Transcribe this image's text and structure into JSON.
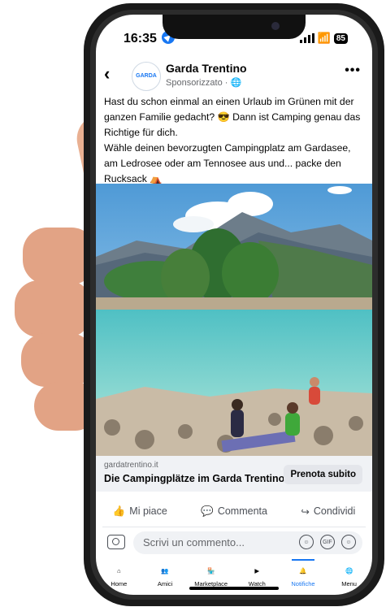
{
  "status": {
    "time": "16:35",
    "battery": "85"
  },
  "post": {
    "page_name": "Garda Trentino",
    "avatar_text": "GARDA",
    "sponsored": "Sponsorizzato · ",
    "caption_line1": "Hast du schon einmal an einen Urlaub im Grünen mit der ganzen Familie gedacht? 😎 Dann ist Camping genau das Richtige für dich.",
    "caption_line2": "Wähle deinen bevorzugten Campingplatz am Gardasee, am Ledrosee oder am Tennosee aus und... packe den Rucksack ⛺"
  },
  "cta": {
    "domain": "gardatrentino.it",
    "title": "Die Campingplätze im Garda Trentino",
    "button": "Prenota subito"
  },
  "actions": {
    "like": "Mi piace",
    "comment": "Commenta",
    "share": "Condividi"
  },
  "comment": {
    "placeholder": "Scrivi un commento...",
    "gif": "GIF"
  },
  "tabs": [
    {
      "label": "Home",
      "icon": "home-icon"
    },
    {
      "label": "Amici",
      "icon": "friends-icon"
    },
    {
      "label": "Marketplace",
      "icon": "marketplace-icon"
    },
    {
      "label": "Watch",
      "icon": "watch-icon"
    },
    {
      "label": "Notifiche",
      "icon": "bell-icon"
    },
    {
      "label": "Menu",
      "icon": "menu-avatar-icon"
    }
  ],
  "colors": {
    "accent": "#1877f2",
    "lake": "#5cc6c4"
  }
}
